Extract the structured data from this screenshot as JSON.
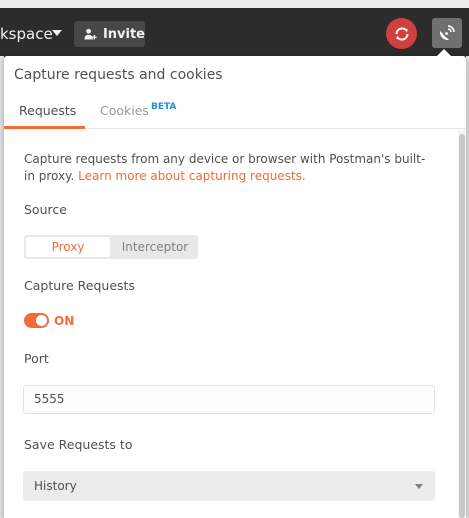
{
  "header": {
    "workspace_label": "kspace",
    "invite_label": "Invite",
    "sync_icon": "sync-icon",
    "capture_icon": "satellite-icon"
  },
  "popover": {
    "title": "Capture requests and cookies",
    "tabs": [
      {
        "label": "Requests",
        "active": true
      },
      {
        "label": "Cookies",
        "badge": "BETA",
        "active": false
      }
    ],
    "description": "Capture requests from any device or browser with Postman's built-in proxy.",
    "learn_more": "Learn more about capturing requests.",
    "source": {
      "label": "Source",
      "options": [
        "Proxy",
        "Interceptor"
      ],
      "selected": "Proxy"
    },
    "capture": {
      "label": "Capture Requests",
      "state": "ON"
    },
    "port": {
      "label": "Port",
      "value": "5555"
    },
    "save_to": {
      "label": "Save Requests to",
      "selected": "History"
    }
  },
  "colors": {
    "accent": "#f26b3a",
    "beta": "#1f8fd6",
    "sync_bg": "#d23f3f",
    "header_bg": "#2c2c2c"
  }
}
